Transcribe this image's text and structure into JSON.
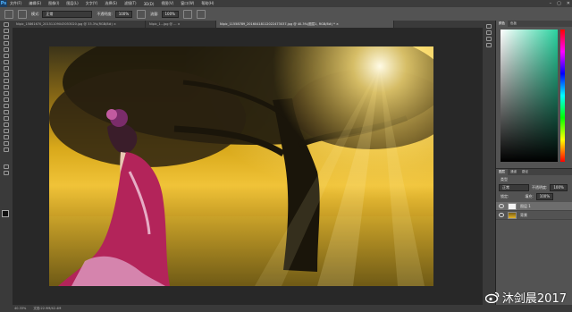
{
  "app": {
    "logo": "Ps"
  },
  "menu": [
    "文件(F)",
    "编辑(E)",
    "图像(I)",
    "图层(L)",
    "文字(Y)",
    "选择(S)",
    "滤镜(T)",
    "3D(D)",
    "视图(V)",
    "窗口(W)",
    "帮助(H)"
  ],
  "window_controls": [
    "–",
    "▢",
    "✕"
  ],
  "options": {
    "mode_label": "模式:",
    "mode_value": "正常",
    "opacity_label": "不透明度:",
    "opacity_value": "100%",
    "flow_label": "流量:",
    "flow_value": "100%"
  },
  "tabs": [
    {
      "label": "Nipic_15861670_20151109043053020.jpg @ 33.3%(RGB/8#) ×",
      "active": false
    },
    {
      "label": "Nipic_1...jpg @ ... ×",
      "active": false
    },
    {
      "label": "Nipic_11558789_20160418112022473037.jpg @ 40.3%(图层1, RGB/8#) * ×",
      "active": true
    }
  ],
  "status": {
    "zoom": "40.33%",
    "doc_size": "文档:22.9M/42.4M"
  },
  "panels": {
    "color_tabs": [
      "颜色",
      "色板"
    ],
    "layers_tabs": [
      "图层",
      "通道",
      "路径"
    ],
    "kind_label": "类型",
    "blend_mode": "正常",
    "opacity_label": "不透明度:",
    "opacity_value": "100%",
    "lock_label": "锁定:",
    "fill_label": "填充:",
    "fill_value": "100%"
  },
  "layers": [
    {
      "name": "图层 1",
      "selected": true
    },
    {
      "name": "背景",
      "selected": false
    }
  ],
  "watermark": {
    "text": "沐剑晨2017"
  },
  "colors": {
    "sun": "#ffe27a",
    "tree": "#1f1a0c",
    "kimono": "#b3245a",
    "ui_dark": "#282828",
    "ui_panel": "#535353"
  }
}
